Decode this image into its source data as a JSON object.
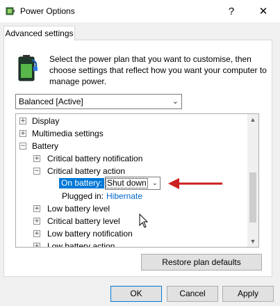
{
  "window": {
    "title": "Power Options",
    "help_glyph": "?",
    "close_glyph": "✕"
  },
  "tab": {
    "label": "Advanced settings"
  },
  "description": "Select the power plan that you want to customise, then choose settings that reflect how you want your computer to manage power.",
  "plan_select": {
    "value": "Balanced [Active]"
  },
  "tree": {
    "items": [
      {
        "label": "Display",
        "expander": "+"
      },
      {
        "label": "Multimedia settings",
        "expander": "+"
      },
      {
        "label": "Battery",
        "expander": "−"
      },
      {
        "label": "Critical battery notification",
        "expander": "+"
      },
      {
        "label": "Critical battery action",
        "expander": "−"
      },
      {
        "label": "Low battery level",
        "expander": "+"
      },
      {
        "label": "Critical battery level",
        "expander": "+"
      },
      {
        "label": "Low battery notification",
        "expander": "+"
      },
      {
        "label": "Low battery action",
        "expander": "+"
      }
    ],
    "on_battery": {
      "label": "On battery:",
      "value": "Shut down"
    },
    "plugged_in": {
      "label": "Plugged in:",
      "value": "Hibernate"
    }
  },
  "buttons": {
    "restore": "Restore plan defaults",
    "ok": "OK",
    "cancel": "Cancel",
    "apply": "Apply"
  },
  "colors": {
    "selection": "#0078d7",
    "link": "#0066cc",
    "annotation_arrow": "#cc1f1f"
  },
  "icons": [
    "power-options-icon",
    "battery-plug-icon",
    "chevron-down-icon",
    "red-arrow-icon",
    "mouse-cursor-icon"
  ]
}
